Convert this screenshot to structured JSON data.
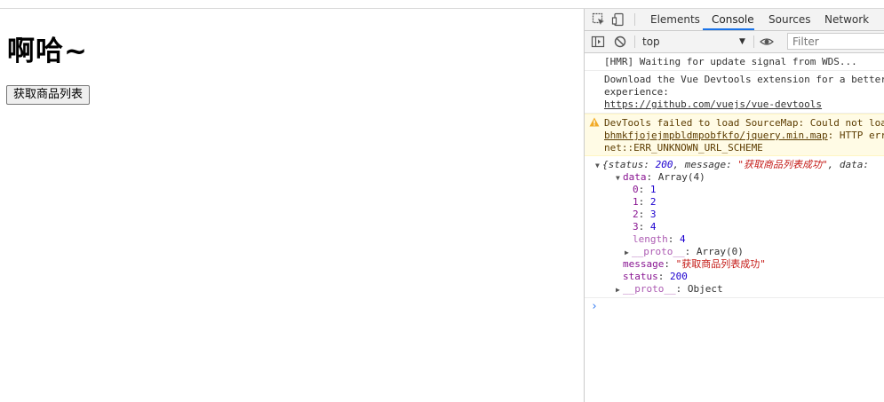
{
  "page": {
    "heading": "啊哈~",
    "button_label": "获取商品列表"
  },
  "devtools": {
    "tabs": [
      {
        "label": "Elements",
        "active": false
      },
      {
        "label": "Console",
        "active": true
      },
      {
        "label": "Sources",
        "active": false
      },
      {
        "label": "Network",
        "active": false
      }
    ],
    "context": "top",
    "filter_placeholder": "Filter",
    "colors": {
      "accent": "#1a73e8",
      "warning_bg": "#fffbe5",
      "key": "#881391",
      "number": "#1c00cf",
      "string": "#c41a16"
    },
    "console": {
      "hmr": "[HMR] Waiting for update signal from WDS...",
      "vue_line1": "Download the Vue Devtools extension for a better",
      "vue_line2": "experience:",
      "vue_link": "https://github.com/vuejs/vue-devtools",
      "warn_line1": "DevTools failed to load SourceMap: Could not loa",
      "warn_link": "bhmkfjojejmpbldmpobfkfo/jquery.min.map",
      "warn_line2_rest": ": HTTP err",
      "warn_line3": "net::ERR_UNKNOWN_URL_SCHEME",
      "obj_summary_pre": "{status: ",
      "obj_summary_status": "200",
      "obj_summary_mid": ", message: ",
      "obj_summary_msg": "\"获取商品列表成功\"",
      "obj_summary_post": ", data:",
      "data_key": "data",
      "data_val": "Array(4)",
      "items": [
        {
          "k": "0",
          "v": "1"
        },
        {
          "k": "1",
          "v": "2"
        },
        {
          "k": "2",
          "v": "3"
        },
        {
          "k": "3",
          "v": "4"
        }
      ],
      "length_key": "length",
      "length_val": "4",
      "proto_key": "__proto__",
      "proto_array": "Array(0)",
      "message_key": "message",
      "message_val": "\"获取商品列表成功\"",
      "status_key": "status",
      "status_val": "200",
      "proto_object": "Object"
    }
  }
}
